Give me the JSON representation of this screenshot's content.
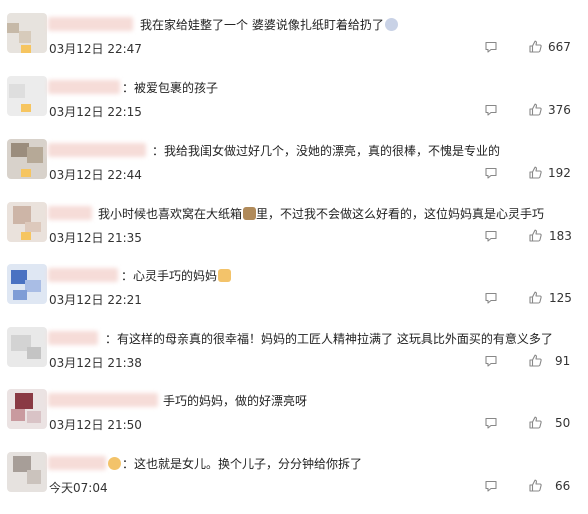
{
  "comments": [
    {
      "text": "我在家给娃整了一个 婆婆说像扎纸盯着给扔了",
      "time": "03月12日 22:47",
      "likes": "667"
    },
    {
      "text": "：被爱包裹的孩子",
      "time": "03月12日 22:15",
      "likes": "376"
    },
    {
      "text": "：我给我闺女做过好几个，没她的漂亮，真的很棒，不愧是专业的",
      "time": "03月12日 22:44",
      "likes": "192"
    },
    {
      "text": "我小时候也喜欢窝在大纸箱",
      "text2": "里，不过我不会做这么好看的，这位妈妈真是心灵手巧",
      "time": "03月12日 21:35",
      "likes": "183"
    },
    {
      "text": "：心灵手巧的妈妈",
      "time": "03月12日 22:21",
      "likes": "125"
    },
    {
      "text": "：有这样的母亲真的很幸福！妈妈的工匠人精神拉满了 这玩具比外面买的有意义多了",
      "time": "03月12日 21:38",
      "likes": "91"
    },
    {
      "text": "手巧的妈妈，做的好漂亮呀",
      "time": "03月12日 21:50",
      "likes": "50"
    },
    {
      "text": "：这也就是女儿。换个儿子，分分钟给你拆了",
      "time": "今天07:04",
      "likes": "66"
    }
  ],
  "icons": {
    "reply": "comment-icon",
    "like": "thumbs-up-icon"
  },
  "colors": {
    "text": "#222222",
    "meta": "#333333",
    "icon": "#888888"
  }
}
